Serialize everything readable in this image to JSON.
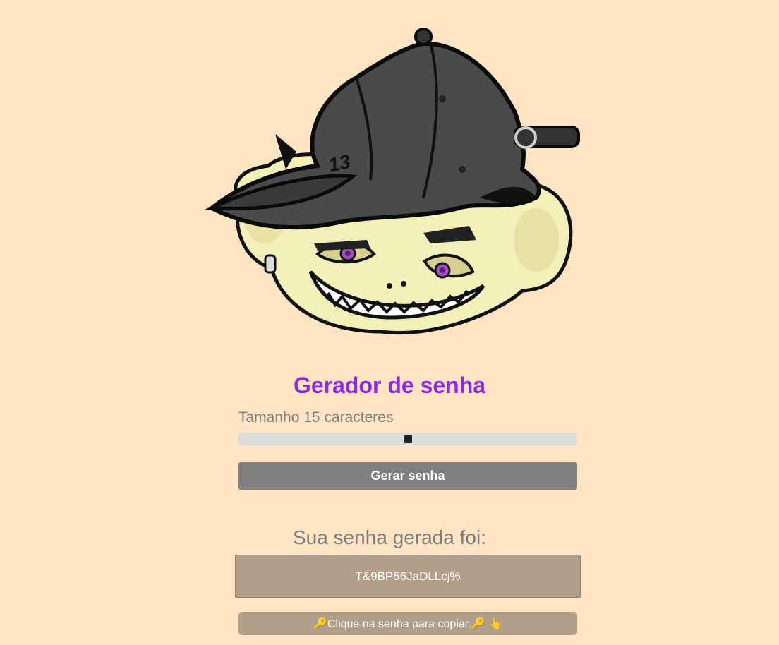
{
  "logo": {
    "icon": "monkey-cap-mascot",
    "cap_number": "13"
  },
  "title": "Gerador de senha",
  "length_label": "Tamanho 15 caracteres",
  "slider": {
    "value": 15,
    "fraction": 0.5
  },
  "generate_button": "Gerar senha",
  "result_title": "Sua senha gerada foi:",
  "password": "T&9BP56JaDLLcj%",
  "copy_hint": "🔑Clique na senha para copiar.🔑 👆",
  "colors": {
    "background": "#ffe4c4",
    "title": "#8a2be2",
    "button": "#808080",
    "password_box": "#b29f8a"
  }
}
